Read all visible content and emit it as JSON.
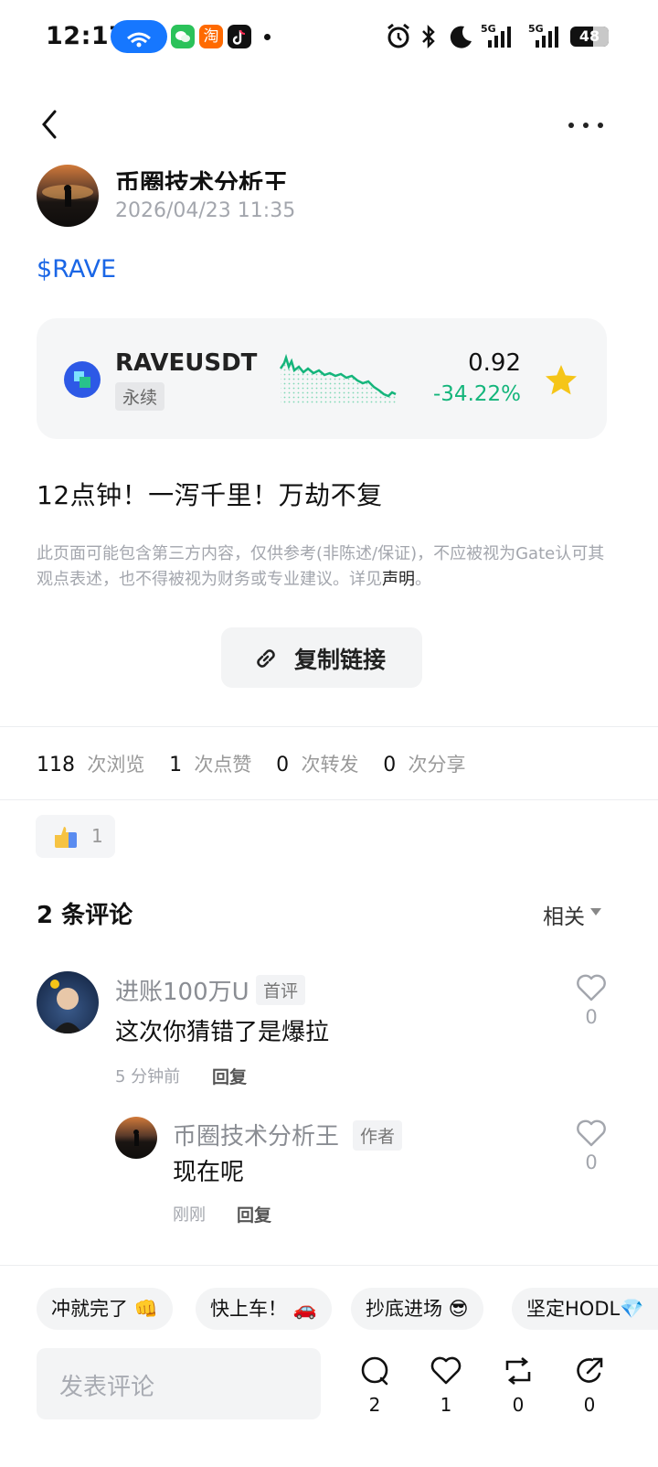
{
  "status_bar": {
    "time": "12:17",
    "net1": "5G",
    "net2": "5G",
    "battery": "48"
  },
  "post": {
    "author": "币圈技术分析王",
    "date": "2026/04/23 11:35",
    "tag": "$RAVE",
    "ticker": {
      "symbol": "RAVEUSDT",
      "type": "永续",
      "price": "0.92",
      "change": "-34.22%"
    },
    "content": "12点钟！一泻千里！万劫不复",
    "disclaimer": "此页面可能包含第三方内容，仅供参考(非陈述/保证)，不应被视为Gate认可其观点表述，也不得被视为财务或专业建议。详见",
    "disclaimer_link": "声明",
    "disclaimer_end": "。",
    "copy_label": "复制链接"
  },
  "stats": {
    "views": "118",
    "views_label": "次浏览",
    "likes": "1",
    "likes_label": "次点赞",
    "reposts": "0",
    "reposts_label": "次转发",
    "shares": "0",
    "shares_label": "次分享"
  },
  "reaction": {
    "count": "1"
  },
  "comments": {
    "title": "2 条评论",
    "sort": "相关",
    "items": [
      {
        "name": "进账100万U",
        "badge": "首评",
        "text": "这次你猜错了是爆拉",
        "time": "5 分钟前",
        "reply": "回复",
        "likes": "0"
      },
      {
        "name": "币圈技术分析王",
        "badge": "作者",
        "text": "现在呢",
        "time": "刚刚",
        "reply": "回复",
        "likes": "0"
      }
    ]
  },
  "quick_replies": [
    "冲就完了 👊",
    "快上车！ 🚗",
    "抄底进场 😎",
    "坚定HODL💎"
  ],
  "bottom_bar": {
    "placeholder": "发表评论",
    "comment_count": "2",
    "like_count": "1",
    "repost_count": "0",
    "share_count": "0"
  },
  "colors": {
    "accent": "#1a66e6",
    "up_green": "#14b57b",
    "star": "#f5c518"
  }
}
